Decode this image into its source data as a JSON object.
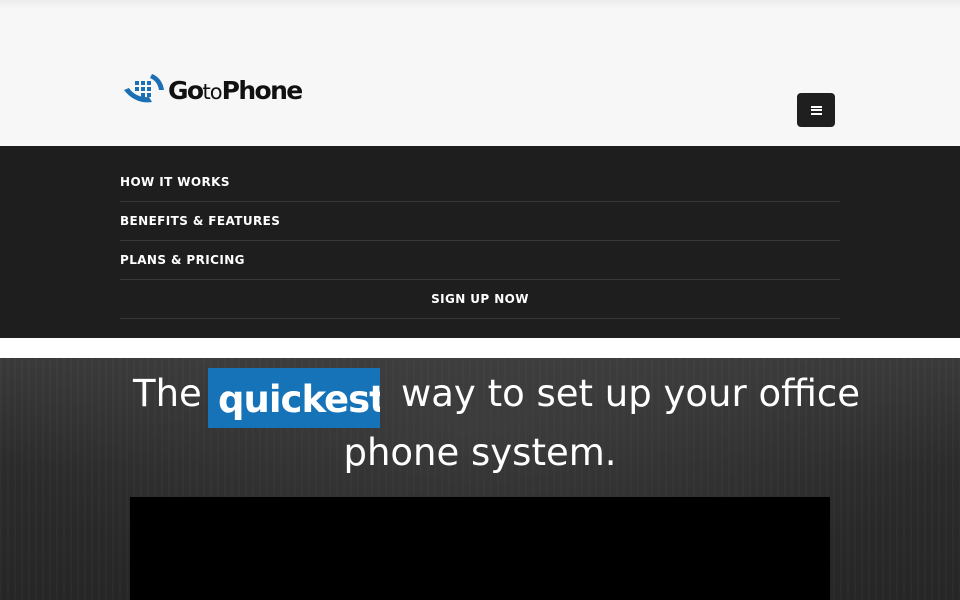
{
  "header": {
    "logo": {
      "text_part1": "Goto",
      "text_part2": "to",
      "text_part3": "Phone",
      "icon": "phone-keypad-icon"
    },
    "menu_toggle_icon": "hamburger-icon"
  },
  "nav": {
    "items": [
      {
        "label": "HOW IT WORKS"
      },
      {
        "label": "BENEFITS & FEATURES"
      },
      {
        "label": "PLANS & PRICING"
      },
      {
        "label": "SIGN UP NOW"
      }
    ]
  },
  "hero": {
    "headline_the": "The",
    "headline_highlight": "quickest",
    "headline_rest_line1": "way to set up your office",
    "headline_line2": "phone system."
  },
  "colors": {
    "nav_background": "#1e1e1e",
    "header_background": "#f7f7f7",
    "highlight_blue": "#1673b8",
    "logo_blue": "#1a6fb5"
  }
}
